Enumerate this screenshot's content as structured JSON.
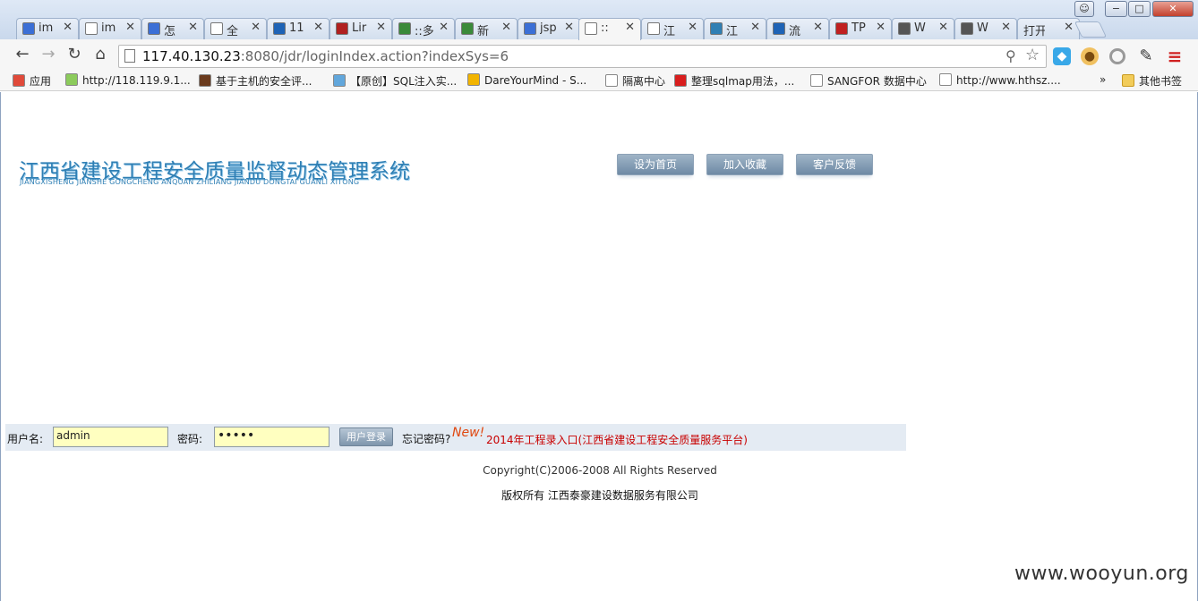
{
  "window": {
    "minimize": "−",
    "maximize": "□",
    "close": "✕"
  },
  "tabs": [
    {
      "label": "im",
      "icon": "paw-icon",
      "color": "#3b6fd6"
    },
    {
      "label": "im",
      "icon": "page-icon",
      "color": "#ffffff"
    },
    {
      "label": "怎",
      "icon": "paw-icon",
      "color": "#3b6fd6"
    },
    {
      "label": "全",
      "icon": "page-icon",
      "color": "#ffffff"
    },
    {
      "label": "11",
      "icon": "telecom-icon",
      "color": "#1e63b6"
    },
    {
      "label": "Lir",
      "icon": "app-icon",
      "color": "#b02020"
    },
    {
      "label": "::多",
      "icon": "leaf-icon",
      "color": "#3a8a3a"
    },
    {
      "label": "新",
      "icon": "leaf-icon",
      "color": "#3a8a3a"
    },
    {
      "label": "jsp",
      "icon": "paw-icon",
      "color": "#3b6fd6"
    },
    {
      "label": "::",
      "icon": "page-icon",
      "color": "#ffffff",
      "active": true
    },
    {
      "label": "江",
      "icon": "page-icon",
      "color": "#ffffff"
    },
    {
      "label": "江",
      "icon": "logo-icon",
      "color": "#2f7fb4"
    },
    {
      "label": "流",
      "icon": "telecom-icon",
      "color": "#1e63b6"
    },
    {
      "label": "TP",
      "icon": "hat-icon",
      "color": "#c02020"
    },
    {
      "label": "W",
      "icon": "cloud-icon",
      "color": "#555555"
    },
    {
      "label": "W",
      "icon": "cloud-icon",
      "color": "#555555"
    },
    {
      "label": "打开",
      "icon": "none",
      "color": "#ffffff"
    }
  ],
  "toolbar": {
    "back": "←",
    "forward": "→",
    "reload": "↻",
    "home": "⌂",
    "url_host": "117.40.130.23",
    "url_rest": ":8080/jdr/loginIndex.action?indexSys=6",
    "key_icon": "🔑",
    "star_icon": "☆",
    "menu_icon": "≡"
  },
  "bookmarks": [
    {
      "label": "应用",
      "icon": "apps-grid-icon"
    },
    {
      "label": "http://118.119.9.1...",
      "icon": "site-icon"
    },
    {
      "label": "基于主机的安全评...",
      "icon": "book-icon"
    },
    {
      "label": "【原创】SQL注入实...",
      "icon": "snowflake-icon"
    },
    {
      "label": "DareYourMind - S...",
      "icon": "radiation-icon"
    },
    {
      "label": "隔离中心",
      "icon": "page-icon"
    },
    {
      "label": "整理sqlmap用法，...",
      "icon": "c-logo-icon"
    },
    {
      "label": "SANGFOR 数据中心",
      "icon": "page-icon"
    },
    {
      "label": "http://www.hthsz....",
      "icon": "page-icon"
    }
  ],
  "bookmarks_more": "»",
  "other_bookmarks": "其他书签",
  "header": {
    "title": "江西省建设工程安全质量监督动态管理系统",
    "subtitle": "JIANGXISHENG JIANSHE GONGCHENG ANQUAN ZHILIANG JIANDU DONGTAI GUANLI XITONG",
    "buttons": [
      "设为首页",
      "加入收藏",
      "客户反馈"
    ]
  },
  "login": {
    "username_label": "用户名:",
    "username_value": "admin",
    "password_label": "密码:",
    "password_value": "•••••",
    "login_button": "用户登录",
    "forgot": "忘记密码?",
    "new_badge": "New!",
    "entry_link": "2014年工程录入口(江西省建设工程安全质量服务平台)"
  },
  "footer": {
    "copyright": "Copyright(C)2006-2008 All Rights Reserved",
    "company": "版权所有 江西泰豪建设数据服务有限公司"
  },
  "watermark": "www.wooyun.org"
}
